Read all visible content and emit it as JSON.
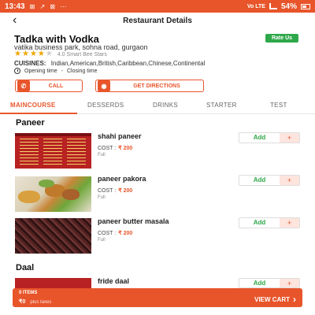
{
  "status_bar": {
    "time": "13:43",
    "icons": "⊠ ↗ ⊠ ⋯",
    "network": "Vo LTE",
    "battery": "54%"
  },
  "app_bar": {
    "title": "Restaurant Details"
  },
  "restaurant": {
    "name": "Tadka with Vodka",
    "rate_badge": "Rate Us",
    "address": "vatika business park, sohna road, gurgaon",
    "rating": 4,
    "rating_text": "4.0 Smart Bee Stars",
    "cuisines_label": "CUISINES:",
    "cuisines": "Indian,American,British,Caribbean,Chinese,Continental",
    "opening": "Opening time",
    "separator": "-",
    "closing": "Closing time"
  },
  "actions": {
    "call": "CALL",
    "directions": "GET DIRECTIONS"
  },
  "tabs": [
    "MAINCOURSE",
    "DESSERDS",
    "DRINKS",
    "STARTER",
    "TEST"
  ],
  "active_tab": 0,
  "sections": [
    {
      "title": "Paneer",
      "items": [
        {
          "name": "shahi paneer",
          "cost_label": "COST :",
          "price": "₹ 200",
          "size": "Full",
          "add": "Add",
          "plus": "+"
        },
        {
          "name": "paneer pakora",
          "cost_label": "COST :",
          "price": "₹ 200",
          "size": "Full",
          "add": "Add",
          "plus": "+"
        },
        {
          "name": "paneer butter masala",
          "cost_label": "COST :",
          "price": "₹ 200",
          "size": "Full",
          "add": "Add",
          "plus": "+"
        }
      ]
    },
    {
      "title": "Daal",
      "items": [
        {
          "name": "fride daal",
          "add": "Add",
          "plus": "+"
        }
      ]
    }
  ],
  "cart": {
    "items": "0 ITEMS",
    "total": "₹0",
    "taxes": "plus taxes",
    "view": "VIEW CART",
    "arrow": "›"
  },
  "colors": {
    "accent": "#e8552b",
    "green": "#2fa84a",
    "star": "#f0a500"
  }
}
